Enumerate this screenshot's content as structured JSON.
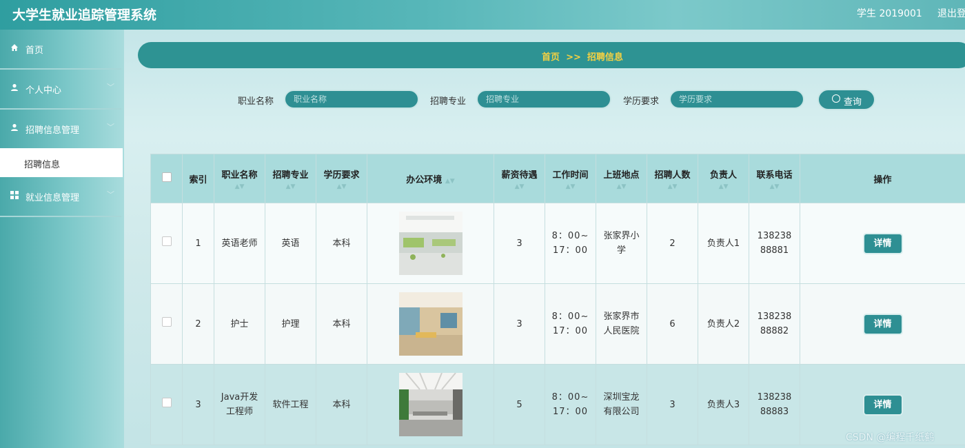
{
  "app": {
    "title": "大学生就业追踪管理系统",
    "user": "学生 2019001",
    "logout": "退出登"
  },
  "sidebar": {
    "items": [
      {
        "label": "首页",
        "icon": "home-icon"
      },
      {
        "label": "个人中心",
        "icon": "user-icon"
      },
      {
        "label": "招聘信息管理",
        "icon": "user-icon"
      },
      {
        "label": "就业信息管理",
        "icon": "grid-icon"
      }
    ],
    "sub_item": "招聘信息"
  },
  "breadcrumb": {
    "text": "首页  >>  招聘信息"
  },
  "search": {
    "job_label": "职业名称",
    "job_placeholder": "职业名称",
    "major_label": "招聘专业",
    "major_placeholder": "招聘专业",
    "edu_label": "学历要求",
    "edu_placeholder": "学历要求",
    "button": "查询"
  },
  "table": {
    "headers": [
      "索引",
      "职业名称",
      "招聘专业",
      "学历要求",
      "办公环境",
      "薪资待遇",
      "工作时间",
      "上班地点",
      "招聘人数",
      "负责人",
      "联系电话",
      "操作"
    ],
    "rows": [
      {
        "index": "1",
        "job": "英语老师",
        "major": "英语",
        "edu": "本科",
        "salary": "3",
        "time": "8：00~17：00",
        "place": "张家界小学",
        "count": "2",
        "owner": "负责人1",
        "phone": "13823888881",
        "action": "详情"
      },
      {
        "index": "2",
        "job": "护士",
        "major": "护理",
        "edu": "本科",
        "salary": "3",
        "time": "8：00~17：00",
        "place": "张家界市人民医院",
        "count": "6",
        "owner": "负责人2",
        "phone": "13823888882",
        "action": "详情"
      },
      {
        "index": "3",
        "job": "Java开发工程师",
        "major": "软件工程",
        "edu": "本科",
        "salary": "5",
        "time": "8：00~17：00",
        "place": "深圳宝龙有限公司",
        "count": "3",
        "owner": "负责人3",
        "phone": "13823888883",
        "action": "详情"
      }
    ]
  },
  "watermark": "CSDN @编程千纸鹤",
  "colors": {
    "accent": "#2e8f93",
    "crumb_text": "#f5d142",
    "header_bg": "#a9dbdc"
  }
}
